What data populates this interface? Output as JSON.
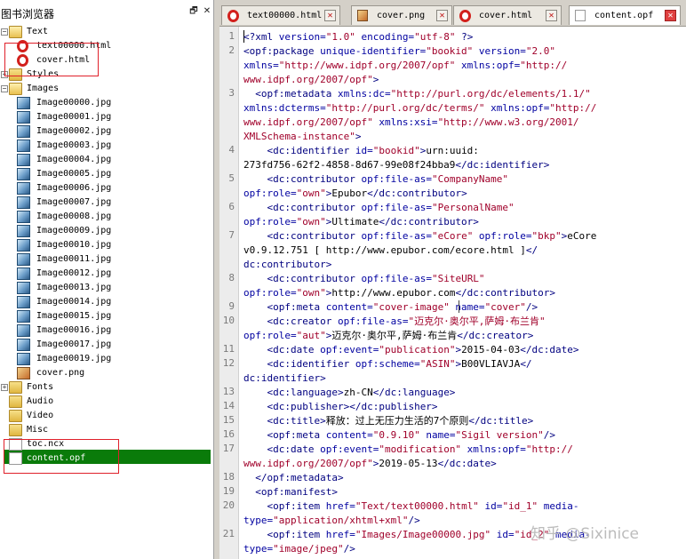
{
  "left_panel": {
    "title": "图书浏览器",
    "float_btn": "🗗",
    "close_btn": "✕"
  },
  "tree": [
    {
      "label": "Text",
      "type": "folder-open",
      "indent": 0,
      "expander": "−"
    },
    {
      "label": "text00000.html",
      "type": "opera",
      "indent": 1
    },
    {
      "label": "cover.html",
      "type": "opera",
      "indent": 1
    },
    {
      "label": "Styles",
      "type": "folder",
      "indent": 0,
      "expander": "+"
    },
    {
      "label": "Images",
      "type": "folder-open",
      "indent": 0,
      "expander": "−"
    },
    {
      "label": "Image00000.jpg",
      "type": "img",
      "indent": 1
    },
    {
      "label": "Image00001.jpg",
      "type": "img",
      "indent": 1
    },
    {
      "label": "Image00002.jpg",
      "type": "img",
      "indent": 1
    },
    {
      "label": "Image00003.jpg",
      "type": "img",
      "indent": 1
    },
    {
      "label": "Image00004.jpg",
      "type": "img",
      "indent": 1
    },
    {
      "label": "Image00005.jpg",
      "type": "img",
      "indent": 1
    },
    {
      "label": "Image00006.jpg",
      "type": "img",
      "indent": 1
    },
    {
      "label": "Image00007.jpg",
      "type": "img",
      "indent": 1
    },
    {
      "label": "Image00008.jpg",
      "type": "img",
      "indent": 1
    },
    {
      "label": "Image00009.jpg",
      "type": "img",
      "indent": 1
    },
    {
      "label": "Image00010.jpg",
      "type": "img",
      "indent": 1
    },
    {
      "label": "Image00011.jpg",
      "type": "img",
      "indent": 1
    },
    {
      "label": "Image00012.jpg",
      "type": "img",
      "indent": 1
    },
    {
      "label": "Image00013.jpg",
      "type": "img",
      "indent": 1
    },
    {
      "label": "Image00014.jpg",
      "type": "img",
      "indent": 1
    },
    {
      "label": "Image00015.jpg",
      "type": "img",
      "indent": 1
    },
    {
      "label": "Image00016.jpg",
      "type": "img",
      "indent": 1
    },
    {
      "label": "Image00017.jpg",
      "type": "img",
      "indent": 1
    },
    {
      "label": "Image00019.jpg",
      "type": "img",
      "indent": 1
    },
    {
      "label": "cover.png",
      "type": "png",
      "indent": 1
    },
    {
      "label": "Fonts",
      "type": "folder",
      "indent": 0,
      "expander": "+"
    },
    {
      "label": "Audio",
      "type": "folder",
      "indent": 0
    },
    {
      "label": "Video",
      "type": "folder",
      "indent": 0
    },
    {
      "label": "Misc",
      "type": "folder",
      "indent": 0
    },
    {
      "label": "toc.ncx",
      "type": "doc",
      "indent": 0
    },
    {
      "label": "content.opf",
      "type": "doc",
      "indent": 0,
      "selected": true
    }
  ],
  "tabs": [
    {
      "label": "text00000.html",
      "icon": "opera"
    },
    {
      "label": "cover.png",
      "icon": "png"
    },
    {
      "label": "cover.html",
      "icon": "opera"
    },
    {
      "label": "content.opf",
      "icon": "doc",
      "active": true
    }
  ],
  "tab_close": "✕",
  "code_lines": [
    {
      "n": "1",
      "parts": [
        [
          "pi",
          "<?xml "
        ],
        [
          "attr",
          "version="
        ],
        [
          "val",
          "\"1.0\""
        ],
        [
          "attr",
          " encoding="
        ],
        [
          "val",
          "\"utf-8\""
        ],
        [
          "pi",
          " ?>"
        ]
      ]
    },
    {
      "n": "2",
      "parts": [
        [
          "tag",
          "<opf:package "
        ],
        [
          "attr",
          "unique-identifier="
        ],
        [
          "val",
          "\"bookid\""
        ],
        [
          "attr",
          " version="
        ],
        [
          "val",
          "\"2.0\""
        ]
      ]
    },
    {
      "n": "",
      "parts": [
        [
          "attr",
          "xmlns="
        ],
        [
          "val",
          "\"http://www.idpf.org/2007/opf\""
        ],
        [
          "attr",
          " xmlns:opf="
        ],
        [
          "val",
          "\"http://"
        ]
      ]
    },
    {
      "n": "",
      "parts": [
        [
          "val",
          "www.idpf.org/2007/opf\""
        ],
        [
          "tag",
          ">"
        ]
      ]
    },
    {
      "n": "3",
      "parts": [
        [
          "tx",
          "  "
        ],
        [
          "tag",
          "<opf:metadata "
        ],
        [
          "attr",
          "xmlns:dc="
        ],
        [
          "val",
          "\"http://purl.org/dc/elements/1.1/\""
        ]
      ]
    },
    {
      "n": "",
      "parts": [
        [
          "attr",
          "xmlns:dcterms="
        ],
        [
          "val",
          "\"http://purl.org/dc/terms/\""
        ],
        [
          "attr",
          " xmlns:opf="
        ],
        [
          "val",
          "\"http://"
        ]
      ]
    },
    {
      "n": "",
      "parts": [
        [
          "val",
          "www.idpf.org/2007/opf\""
        ],
        [
          "attr",
          " xmlns:xsi="
        ],
        [
          "val",
          "\"http://www.w3.org/2001/"
        ]
      ]
    },
    {
      "n": "",
      "parts": [
        [
          "val",
          "XMLSchema-instance\""
        ],
        [
          "tag",
          ">"
        ]
      ]
    },
    {
      "n": "4",
      "parts": [
        [
          "tx",
          "    "
        ],
        [
          "tag",
          "<dc:identifier "
        ],
        [
          "attr",
          "id="
        ],
        [
          "val",
          "\"bookid\""
        ],
        [
          "tag",
          ">"
        ],
        [
          "tx",
          "urn:uuid:"
        ]
      ]
    },
    {
      "n": "",
      "parts": [
        [
          "tx",
          "273fd756-62f2-4858-8d67-99e08f24bba9"
        ],
        [
          "tag",
          "</dc:identifier>"
        ]
      ]
    },
    {
      "n": "5",
      "parts": [
        [
          "tx",
          "    "
        ],
        [
          "tag",
          "<dc:contributor "
        ],
        [
          "attr",
          "opf:file-as="
        ],
        [
          "val",
          "\"CompanyName\""
        ]
      ]
    },
    {
      "n": "",
      "parts": [
        [
          "attr",
          "opf:role="
        ],
        [
          "val",
          "\"own\""
        ],
        [
          "tag",
          ">"
        ],
        [
          "tx",
          "Epubor"
        ],
        [
          "tag",
          "</dc:contributor>"
        ]
      ]
    },
    {
      "n": "6",
      "parts": [
        [
          "tx",
          "    "
        ],
        [
          "tag",
          "<dc:contributor "
        ],
        [
          "attr",
          "opf:file-as="
        ],
        [
          "val",
          "\"PersonalName\""
        ]
      ]
    },
    {
      "n": "",
      "parts": [
        [
          "attr",
          "opf:role="
        ],
        [
          "val",
          "\"own\""
        ],
        [
          "tag",
          ">"
        ],
        [
          "tx",
          "Ultimate"
        ],
        [
          "tag",
          "</dc:contributor>"
        ]
      ]
    },
    {
      "n": "7",
      "parts": [
        [
          "tx",
          "    "
        ],
        [
          "tag",
          "<dc:contributor "
        ],
        [
          "attr",
          "opf:file-as="
        ],
        [
          "val",
          "\"eCore\""
        ],
        [
          "attr",
          " opf:role="
        ],
        [
          "val",
          "\"bkp\""
        ],
        [
          "tag",
          ">"
        ],
        [
          "tx",
          "eCore"
        ]
      ]
    },
    {
      "n": "",
      "parts": [
        [
          "tx",
          "v0.9.12.751 [ http://www.epubor.com/ecore.html ]"
        ],
        [
          "tag",
          "</"
        ]
      ]
    },
    {
      "n": "",
      "parts": [
        [
          "tag",
          "dc:contributor>"
        ]
      ]
    },
    {
      "n": "8",
      "parts": [
        [
          "tx",
          "    "
        ],
        [
          "tag",
          "<dc:contributor "
        ],
        [
          "attr",
          "opf:file-as="
        ],
        [
          "val",
          "\"SiteURL\""
        ]
      ]
    },
    {
      "n": "",
      "parts": [
        [
          "attr",
          "opf:role="
        ],
        [
          "val",
          "\"own\""
        ],
        [
          "tag",
          ">"
        ],
        [
          "tx",
          "http://www.epubor.com"
        ],
        [
          "tag",
          "</dc:contributor>"
        ]
      ]
    },
    {
      "n": "9",
      "parts": [
        [
          "tx",
          "    "
        ],
        [
          "tag",
          "<opf:meta "
        ],
        [
          "attr",
          "content="
        ],
        [
          "val",
          "\"cover-image\""
        ],
        [
          "attr",
          " name="
        ],
        [
          "val",
          "\"cover\""
        ],
        [
          "tag",
          "/>"
        ]
      ]
    },
    {
      "n": "10",
      "parts": [
        [
          "tx",
          "    "
        ],
        [
          "tag",
          "<dc:creator "
        ],
        [
          "attr",
          "opf:file-as="
        ],
        [
          "val",
          "\"迈克尔·奥尔平,萨姆·布兰肯\""
        ]
      ]
    },
    {
      "n": "",
      "parts": [
        [
          "attr",
          "opf:role="
        ],
        [
          "val",
          "\"aut\""
        ],
        [
          "tag",
          ">"
        ],
        [
          "tx",
          "迈克尔·奥尔平,萨姆·布兰肯"
        ],
        [
          "tag",
          "</dc:creator>"
        ]
      ]
    },
    {
      "n": "11",
      "parts": [
        [
          "tx",
          "    "
        ],
        [
          "tag",
          "<dc:date "
        ],
        [
          "attr",
          "opf:event="
        ],
        [
          "val",
          "\"publication\""
        ],
        [
          "tag",
          ">"
        ],
        [
          "tx",
          "2015-04-03"
        ],
        [
          "tag",
          "</dc:date>"
        ]
      ]
    },
    {
      "n": "12",
      "parts": [
        [
          "tx",
          "    "
        ],
        [
          "tag",
          "<dc:identifier "
        ],
        [
          "attr",
          "opf:scheme="
        ],
        [
          "val",
          "\"ASIN\""
        ],
        [
          "tag",
          ">"
        ],
        [
          "tx",
          "B00VLIAVJA"
        ],
        [
          "tag",
          "</"
        ]
      ]
    },
    {
      "n": "",
      "parts": [
        [
          "tag",
          "dc:identifier>"
        ]
      ]
    },
    {
      "n": "13",
      "parts": [
        [
          "tx",
          "    "
        ],
        [
          "tag",
          "<dc:language>"
        ],
        [
          "tx",
          "zh-CN"
        ],
        [
          "tag",
          "</dc:language>"
        ]
      ]
    },
    {
      "n": "14",
      "parts": [
        [
          "tx",
          "    "
        ],
        [
          "tag",
          "<dc:publisher>"
        ],
        [
          "tag",
          "</dc:publisher>"
        ]
      ]
    },
    {
      "n": "15",
      "parts": [
        [
          "tx",
          "    "
        ],
        [
          "tag",
          "<dc:title>"
        ],
        [
          "tx",
          "释放：过上无压力生活的7个原则"
        ],
        [
          "tag",
          "</dc:title>"
        ]
      ]
    },
    {
      "n": "16",
      "parts": [
        [
          "tx",
          "    "
        ],
        [
          "tag",
          "<opf:meta "
        ],
        [
          "attr",
          "content="
        ],
        [
          "val",
          "\"0.9.10\""
        ],
        [
          "attr",
          " name="
        ],
        [
          "val",
          "\"Sigil version\""
        ],
        [
          "tag",
          "/>"
        ]
      ]
    },
    {
      "n": "17",
      "parts": [
        [
          "tx",
          "    "
        ],
        [
          "tag",
          "<dc:date "
        ],
        [
          "attr",
          "opf:event="
        ],
        [
          "val",
          "\"modification\""
        ],
        [
          "attr",
          " xmlns:opf="
        ],
        [
          "val",
          "\"http://"
        ]
      ]
    },
    {
      "n": "",
      "parts": [
        [
          "val",
          "www.idpf.org/2007/opf\""
        ],
        [
          "tag",
          ">"
        ],
        [
          "tx",
          "2019-05-13"
        ],
        [
          "tag",
          "</dc:date>"
        ]
      ]
    },
    {
      "n": "18",
      "parts": [
        [
          "tx",
          "  "
        ],
        [
          "tag",
          "</opf:metadata>"
        ]
      ]
    },
    {
      "n": "19",
      "parts": [
        [
          "tx",
          "  "
        ],
        [
          "tag",
          "<opf:manifest>"
        ]
      ]
    },
    {
      "n": "20",
      "parts": [
        [
          "tx",
          "    "
        ],
        [
          "tag",
          "<opf:item "
        ],
        [
          "attr",
          "href="
        ],
        [
          "val",
          "\"Text/text00000.html\""
        ],
        [
          "attr",
          " id="
        ],
        [
          "val",
          "\"id_1\""
        ],
        [
          "attr",
          " media-"
        ]
      ]
    },
    {
      "n": "",
      "parts": [
        [
          "attr",
          "type="
        ],
        [
          "val",
          "\"application/xhtml+xml\""
        ],
        [
          "tag",
          "/>"
        ]
      ]
    },
    {
      "n": "21",
      "parts": [
        [
          "tx",
          "    "
        ],
        [
          "tag",
          "<opf:item "
        ],
        [
          "attr",
          "href="
        ],
        [
          "val",
          "\"Images/Image00000.jpg\""
        ],
        [
          "attr",
          " id="
        ],
        [
          "val",
          "\"id_2\""
        ],
        [
          "attr",
          " media-"
        ]
      ]
    },
    {
      "n": "",
      "parts": [
        [
          "attr",
          "type="
        ],
        [
          "val",
          "\"image/jpeg\""
        ],
        [
          "tag",
          "/>"
        ]
      ]
    }
  ],
  "watermark": "知乎 @Sixinice"
}
